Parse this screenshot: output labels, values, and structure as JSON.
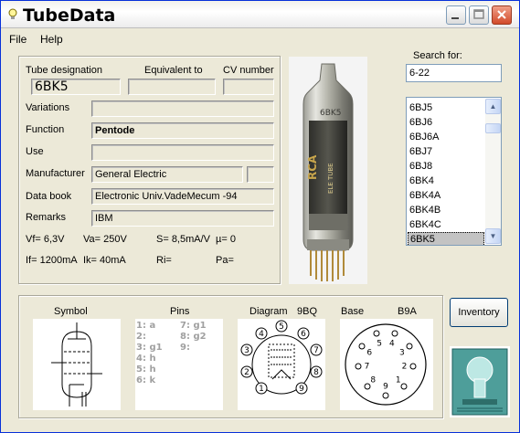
{
  "window": {
    "title": "TubeData"
  },
  "menu": {
    "file": "File",
    "help": "Help"
  },
  "details": {
    "tube_designation_label": "Tube designation",
    "equivalent_label": "Equivalent to",
    "cv_label": "CV number",
    "tube_designation": "6BK5",
    "equivalent": "",
    "cv_number": "",
    "variations_label": "Variations",
    "variations": "",
    "function_label": "Function",
    "function": "Pentode",
    "use_label": "Use",
    "use": "",
    "manufacturer_label": "Manufacturer",
    "manufacturer": "General Electric",
    "manufacturer_extra": "",
    "databook_label": "Data book",
    "databook": "Electronic Univ.VadeMecum -94",
    "remarks_label": "Remarks",
    "remarks": "IBM",
    "params_row1": {
      "vf": "Vf= 6,3V",
      "va": "Va= 250V",
      "s": "S= 8,5mA/V",
      "mu": "µ=   0"
    },
    "params_row2": {
      "if": "If= 1200mA",
      "ik": "Ik=  40mA",
      "ri": "Ri=",
      "pa": "Pa="
    }
  },
  "search": {
    "label": "Search for:",
    "value": "6-22",
    "results": [
      "6BJ5",
      "6BJ6",
      "6BJ6A",
      "6BJ7",
      "6BJ8",
      "6BK4",
      "6BK4A",
      "6BK4B",
      "6BK4C",
      "6BK5"
    ],
    "selected": "6BK5"
  },
  "bottom": {
    "symbol_label": "Symbol",
    "pins_label": "Pins",
    "diagram_label": "Diagram",
    "diagram_code": "9BQ",
    "base_label": "Base",
    "base_code": "B9A",
    "pins_col1": [
      "1: a",
      "2:",
      "3: g1",
      "4: h",
      "5: h",
      "6: k"
    ],
    "pins_col2": [
      "7: g1",
      "8: g2",
      "9:"
    ],
    "diagram_numbers": [
      "1",
      "2",
      "3",
      "4",
      "5",
      "6",
      "7",
      "8",
      "9"
    ],
    "base_numbers": [
      "1",
      "2",
      "3",
      "4",
      "5",
      "6",
      "7",
      "8",
      "9"
    ]
  },
  "actions": {
    "inventory": "Inventory"
  },
  "colors": {
    "title_bar_border": "#0831D9",
    "close_button": "#D24A2A",
    "selection": "#C3C3C3",
    "pins_text": "#A0A0A0"
  }
}
